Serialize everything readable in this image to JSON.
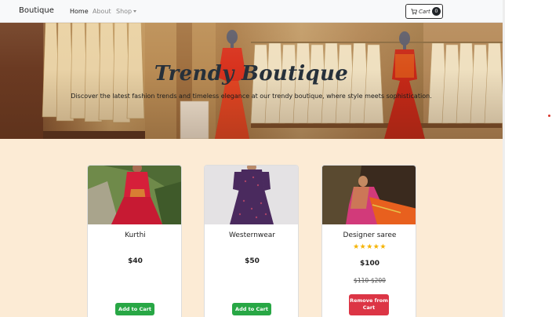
{
  "navbar": {
    "brand": "Boutique",
    "links": [
      {
        "label": "Home",
        "active": true
      },
      {
        "label": "About",
        "active": false
      },
      {
        "label": "Shop",
        "active": false,
        "dropdown": true
      }
    ],
    "cart": {
      "label": "Cart",
      "count": "0",
      "icon": "cart-icon"
    }
  },
  "hero": {
    "title": "Trendy Boutique",
    "subtitle": "Discover the latest fashion trends and timeless elegance at our trendy boutique, where style meets sophistication."
  },
  "products": [
    {
      "name": "Kurthi",
      "price": "$40",
      "action": "Add to Cart",
      "action_type": "add"
    },
    {
      "name": "Westernwear",
      "price": "$50",
      "action": "Add to Cart",
      "action_type": "add"
    },
    {
      "name": "Designer saree",
      "stars": "★★★★★",
      "rating": 5,
      "price": "$100",
      "old_price": "$110-$200",
      "action": "Remove from Cart",
      "action_type": "remove"
    }
  ],
  "colors": {
    "page_bg": "#fcebd5",
    "add_button": "#28a745",
    "remove_button": "#dc3545",
    "star": "#f5b301",
    "navbar_bg": "#f8f9fa"
  }
}
